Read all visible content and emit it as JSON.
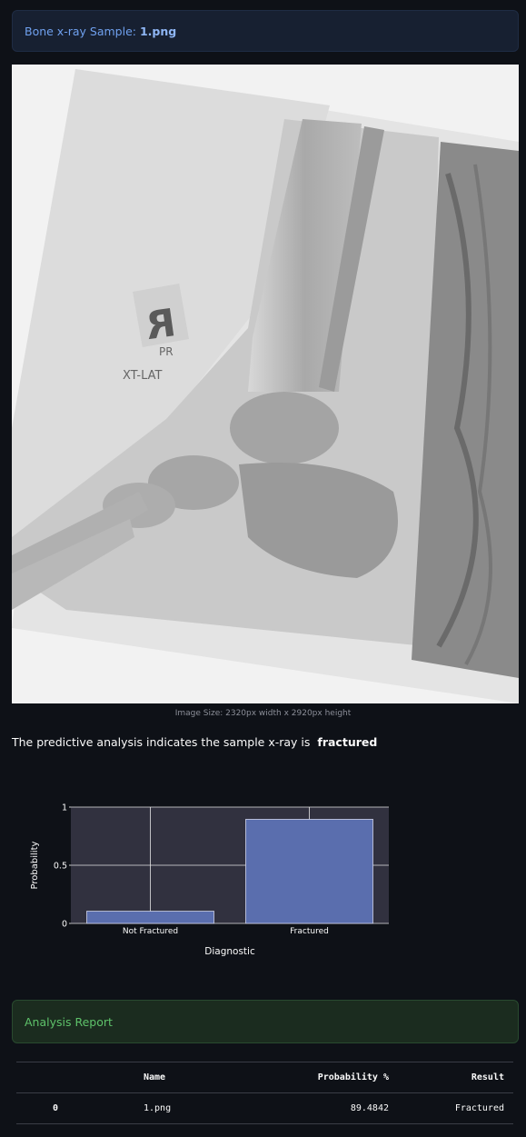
{
  "info": {
    "prefix": "Bone x-ray Sample:",
    "filename": "1.png"
  },
  "image": {
    "marker_letter": "R",
    "marker_pr": "PR",
    "view_label": "XT-LAT"
  },
  "caption": "Image Size: 2320px width x 2920px height",
  "prediction": {
    "text": "The predictive analysis indicates the sample x-ray is",
    "result": "fractured"
  },
  "chart_data": {
    "type": "bar",
    "categories": [
      "Not Fractured",
      "Fractured"
    ],
    "values": [
      0.105158,
      0.894842
    ],
    "xlabel": "Diagnostic",
    "ylabel": "Probability",
    "ylim": [
      0,
      1
    ],
    "yticks": [
      "0",
      "0.5",
      "1"
    ],
    "bar_color": "#5a6eae",
    "plot_bg": "#31313f",
    "grid": true
  },
  "report": {
    "title": "Analysis Report",
    "headers": [
      "",
      "Name",
      "Probability %",
      "Result"
    ],
    "rows": [
      [
        "0",
        "1.png",
        "89.4842",
        "Fractured"
      ]
    ]
  }
}
